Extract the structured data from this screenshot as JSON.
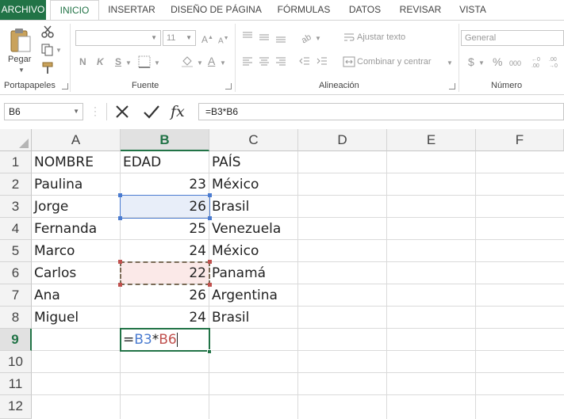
{
  "ribbon_tabs": [
    "ARCHIVO",
    "INICIO",
    "INSERTAR",
    "DISEÑO DE PÁGINA",
    "FÓRMULAS",
    "DATOS",
    "REVISAR",
    "VISTA"
  ],
  "active_tab": "INICIO",
  "clipboard": {
    "paste_label": "Pegar",
    "group_label": "Portapapeles"
  },
  "font_group": {
    "font_name": "",
    "font_size": "11",
    "bold": "N",
    "italic": "K",
    "underline": "S",
    "group_label": "Fuente"
  },
  "alignment_group": {
    "wrap_text": "Ajustar texto",
    "merge_center": "Combinar y centrar",
    "group_label": "Alineación"
  },
  "number_group": {
    "format": "General",
    "currency": "$",
    "percent": "%",
    "thousands": "000",
    "group_label": "Número"
  },
  "formula_bar": {
    "name_box": "B6",
    "formula": "=B3*B6",
    "fx": "fx"
  },
  "columns": [
    "A",
    "B",
    "C",
    "D",
    "E",
    "F"
  ],
  "selected_column": "B",
  "rows": [
    "1",
    "2",
    "3",
    "4",
    "5",
    "6",
    "7",
    "8",
    "9",
    "10",
    "11",
    "12"
  ],
  "selected_row": "9",
  "headers": {
    "a": "NOMBRE",
    "b": "EDAD",
    "c": "PAÍS"
  },
  "table": [
    {
      "name": "Paulina",
      "age": "23",
      "country": "México"
    },
    {
      "name": "Jorge",
      "age": "26",
      "country": "Brasil"
    },
    {
      "name": "Fernanda",
      "age": "25",
      "country": "Venezuela"
    },
    {
      "name": "Marco",
      "age": "24",
      "country": "México"
    },
    {
      "name": "Carlos",
      "age": "22",
      "country": "Panamá"
    },
    {
      "name": "Ana",
      "age": "26",
      "country": "Argentina"
    },
    {
      "name": "Miguel",
      "age": "24",
      "country": "Brasil"
    }
  ],
  "editing_cell": {
    "eq": "=",
    "ref1": "B3",
    "op": "*",
    "ref2": "B6"
  },
  "colors": {
    "excel_green": "#217346",
    "ref_blue": "#4a7bd0",
    "ref_red": "#c0504d"
  }
}
